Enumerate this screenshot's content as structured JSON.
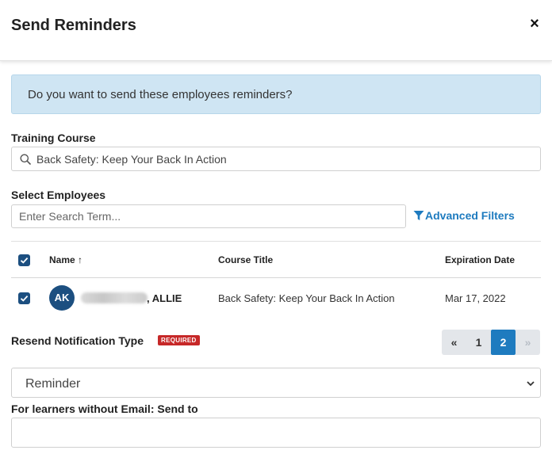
{
  "modal": {
    "title": "Send Reminders",
    "close_label": "×"
  },
  "info": {
    "message": "Do you want to send these employees reminders?"
  },
  "training_course": {
    "label": "Training Course",
    "value": "Back Safety: Keep Your Back In Action"
  },
  "select_employees": {
    "label": "Select Employees",
    "search_placeholder": "Enter Search Term...",
    "advanced_filters_label": "Advanced Filters"
  },
  "table": {
    "headers": {
      "name": "Name ↑",
      "course_title": "Course Title",
      "expiration_date": "Expiration Date"
    },
    "rows": [
      {
        "initials": "AK",
        "first_name": ", ALLIE",
        "course_title": "Back Safety: Keep Your Back In Action",
        "expiration_date": "Mar 17, 2022",
        "checked": true
      }
    ]
  },
  "resend": {
    "label": "Resend Notification Type",
    "required_badge": "REQUIRED",
    "selected": "Reminder"
  },
  "pagination": {
    "prev_label": "«",
    "pages": [
      "1",
      "2"
    ],
    "current_page": "2",
    "next_label": "»"
  },
  "send_to": {
    "label": "For learners without Email: Send to",
    "value": ""
  },
  "colors": {
    "primary": "#1c4f80",
    "link": "#1e7bbf",
    "info_bg": "#cfe5f3",
    "required": "#c62828"
  }
}
